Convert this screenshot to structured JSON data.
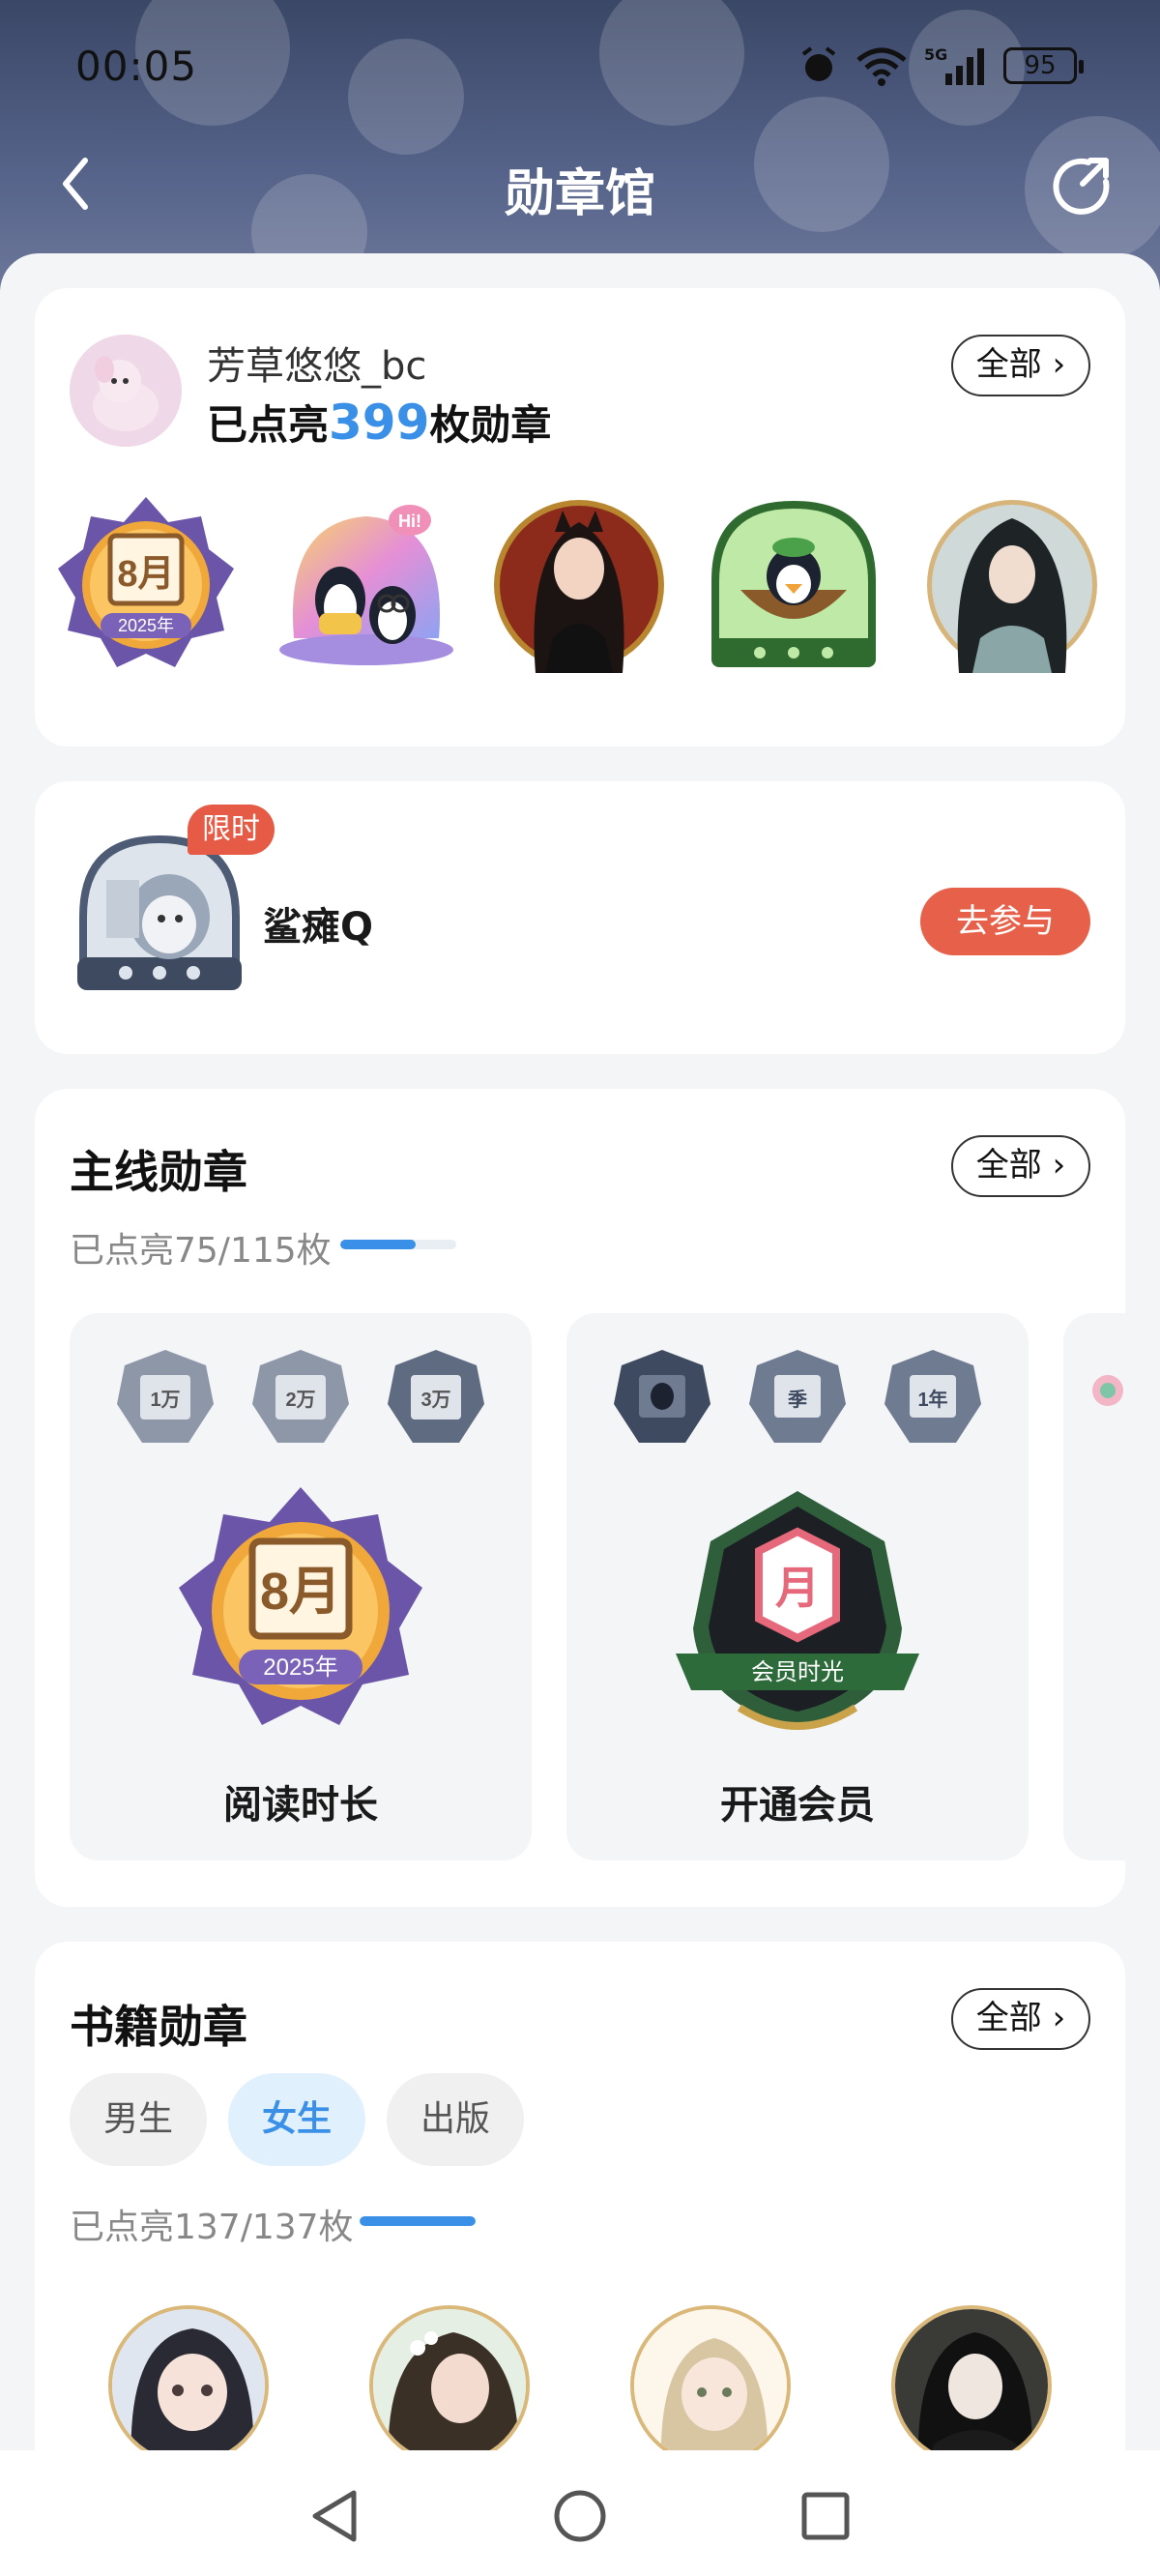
{
  "status_bar": {
    "time": "00:05",
    "battery": "95"
  },
  "header": {
    "title": "勋章馆"
  },
  "profile": {
    "username": "芳草悠悠_bc",
    "lit_prefix": "已点亮",
    "lit_count": "399",
    "lit_suffix": "枚勋章",
    "all_label": "全部",
    "badges": [
      {
        "name": "阅读时长 8月 2025年",
        "line1": "8月",
        "line2": "2025年"
      },
      {
        "name": "企鹅 Hi",
        "line1": "Hi!"
      },
      {
        "name": "角色头像1"
      },
      {
        "name": "企鹅椰子碗"
      },
      {
        "name": "角色头像2"
      }
    ]
  },
  "limited": {
    "tag": "限时",
    "name": "鲨瘫Q",
    "action": "去参与"
  },
  "main_section": {
    "title": "主线勋章",
    "all_label": "全部",
    "progress_text": "已点亮75/115枚",
    "progress": 0.652,
    "tiles": [
      {
        "name": "阅读时长",
        "smalls": [
          "1万",
          "2万",
          "3万"
        ],
        "big_line1": "8月",
        "big_line2": "2025年"
      },
      {
        "name": "开通会员",
        "smalls": [
          "",
          "季",
          "1年"
        ],
        "big_line1": "月",
        "big_line2": "会员时光"
      }
    ]
  },
  "books_section": {
    "title": "书籍勋章",
    "all_label": "全部",
    "chips": [
      "男生",
      "女生",
      "出版"
    ],
    "active_chip": "女生",
    "progress_text": "已点亮137/137枚",
    "progress": 1.0
  },
  "colors": {
    "accent": "#3a8fe6",
    "action": "#e6604a",
    "header_bg": "#4a5778"
  }
}
